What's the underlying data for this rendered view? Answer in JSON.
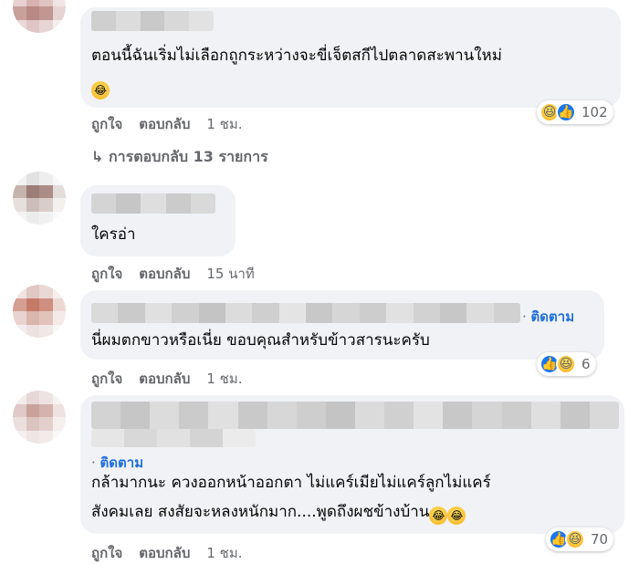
{
  "comments": [
    {
      "text": "ตอนนี้ฉันเริ่มไม่เลือกถูกระหว่างจะขี่เจ็ตสกีไปตลาดสะพานใหม่",
      "like": "ถูกใจ",
      "reply": "ตอบกลับ",
      "time": "1 ชม.",
      "reaction_count": "102",
      "replies_label": "↳ การตอบกลับ 13 รายการ"
    },
    {
      "text": "ใครอ่า",
      "like": "ถูกใจ",
      "reply": "ตอบกลับ",
      "time": "15 นาที"
    },
    {
      "follow": "ติดตาม",
      "text": "นี่ผมตกขาวหรือเนี่ย ขอบคุณสำหรับข้าวสารนะครับ",
      "like": "ถูกใจ",
      "reply": "ตอบกลับ",
      "time": "1 ชม.",
      "reaction_count": "6"
    },
    {
      "follow": "ติดตาม",
      "text_line1": "กล้ามากนะ ควงออกหน้าออกตา ไม่แคร์เมียไม่แคร์ลูกไม่แคร์",
      "text_line2": "สังคมเลย สงสัยจะหลงหนักมาก....พูดถึงผชข้างบ้าน",
      "like": "ถูกใจ",
      "reply": "ตอบกลับ",
      "time": "1 ชม.",
      "reaction_count": "70"
    }
  ],
  "colors": {
    "bubble": "#f0f2f5",
    "action": "#65676b",
    "link": "#216fdb"
  },
  "icons": [
    "haha-reaction-icon",
    "like-reaction-icon",
    "laughing-emoji"
  ]
}
